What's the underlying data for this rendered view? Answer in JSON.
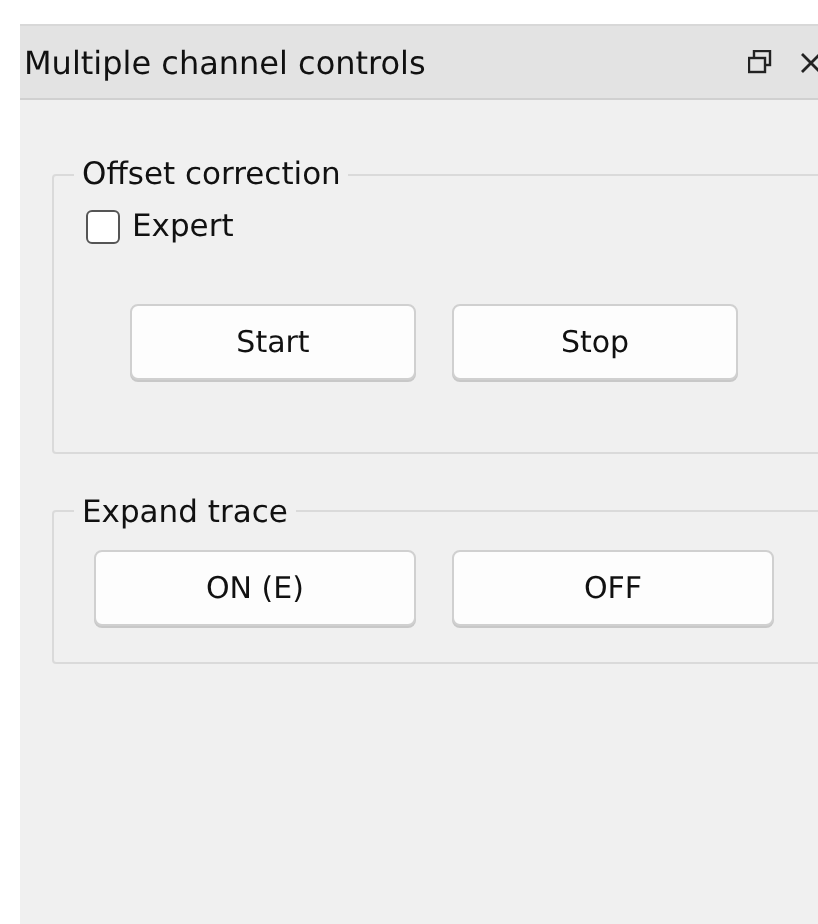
{
  "window": {
    "title": "Multiple channel controls"
  },
  "groups": [
    {
      "title": "Offset correction",
      "checkbox": {
        "label": "Expert",
        "checked": false
      },
      "buttons": [
        "Start",
        "Stop"
      ]
    },
    {
      "title": "Expand trace",
      "buttons": [
        "ON (E)",
        "OFF"
      ]
    }
  ]
}
